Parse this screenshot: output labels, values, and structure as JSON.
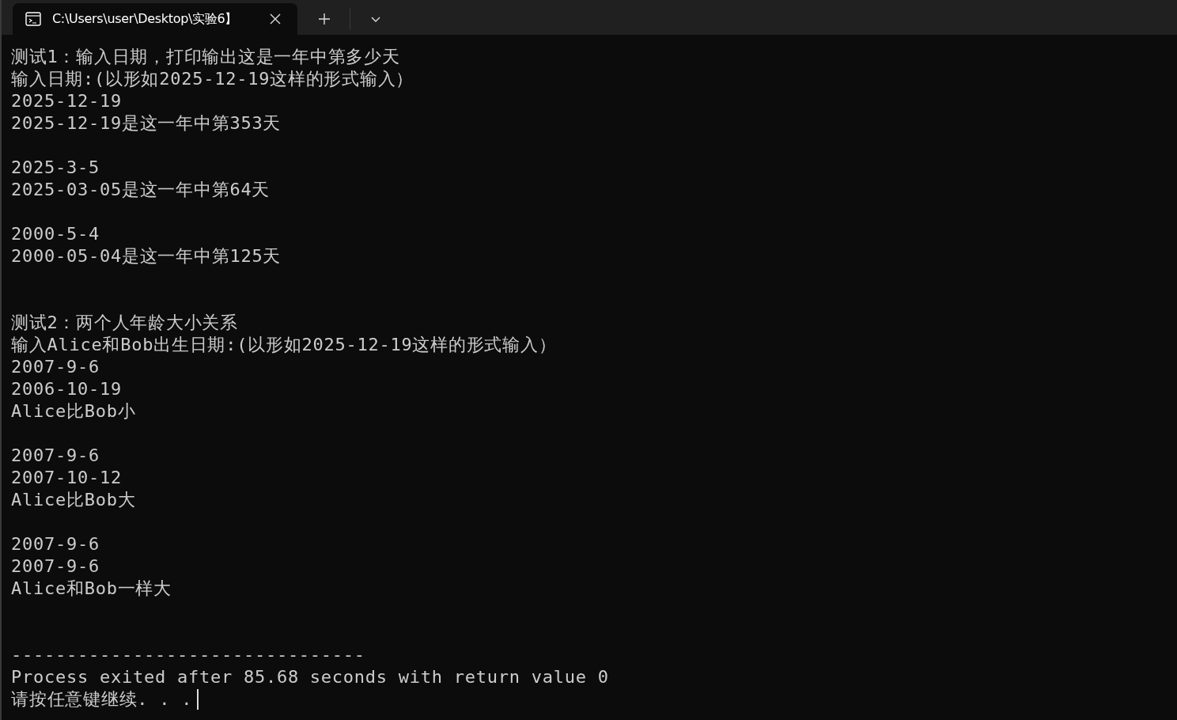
{
  "tabs": [
    {
      "title": "C:\\Users\\user\\Desktop\\实验6】",
      "selected": true
    }
  ],
  "terminal": {
    "lines": [
      {
        "kind": "text",
        "text": "测试1：输入日期，打印输出这是一年中第多少天"
      },
      {
        "kind": "text",
        "text": "输入日期:(以形如2025-12-19这样的形式输入）"
      },
      {
        "kind": "text",
        "text": "2025-12-19"
      },
      {
        "kind": "text",
        "text": "2025-12-19是这一年中第353天"
      },
      {
        "kind": "blank"
      },
      {
        "kind": "text",
        "text": "2025-3-5"
      },
      {
        "kind": "text",
        "text": "2025-03-05是这一年中第64天"
      },
      {
        "kind": "blank"
      },
      {
        "kind": "text",
        "text": "2000-5-4"
      },
      {
        "kind": "text",
        "text": "2000-05-04是这一年中第125天"
      },
      {
        "kind": "blank"
      },
      {
        "kind": "blank"
      },
      {
        "kind": "text",
        "text": "测试2：两个人年龄大小关系"
      },
      {
        "kind": "text",
        "text": "输入Alice和Bob出生日期:(以形如2025-12-19这样的形式输入）"
      },
      {
        "kind": "text",
        "text": "2007-9-6"
      },
      {
        "kind": "text",
        "text": "2006-10-19"
      },
      {
        "kind": "text",
        "text": "Alice比Bob小"
      },
      {
        "kind": "blank"
      },
      {
        "kind": "text",
        "text": "2007-9-6"
      },
      {
        "kind": "text",
        "text": "2007-10-12"
      },
      {
        "kind": "text",
        "text": "Alice比Bob大"
      },
      {
        "kind": "blank"
      },
      {
        "kind": "text",
        "text": "2007-9-6"
      },
      {
        "kind": "text",
        "text": "2007-9-6"
      },
      {
        "kind": "text",
        "text": "Alice和Bob一样大"
      },
      {
        "kind": "blank"
      },
      {
        "kind": "blank"
      },
      {
        "kind": "text",
        "text": "--------------------------------"
      },
      {
        "kind": "text",
        "text": "Process exited after 85.68 seconds with return value 0"
      },
      {
        "kind": "text",
        "text": "请按任意键继续. . ."
      }
    ],
    "cursor": true
  }
}
